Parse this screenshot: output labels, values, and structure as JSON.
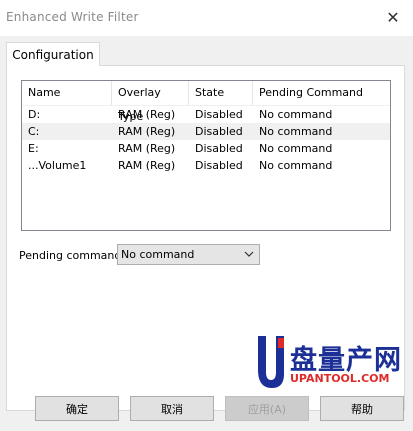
{
  "window": {
    "title": "Enhanced Write Filter",
    "close_glyph": "✕"
  },
  "tabs": [
    {
      "label": "Configuration"
    }
  ],
  "list": {
    "columns": [
      "Name",
      "Overlay Type",
      "State",
      "Pending Command"
    ],
    "rows": [
      [
        "D:",
        "RAM (Reg)",
        "Disabled",
        "No command"
      ],
      [
        "C:",
        "RAM (Reg)",
        "Disabled",
        "No command"
      ],
      [
        "E:",
        "RAM (Reg)",
        "Disabled",
        "No command"
      ],
      [
        "...Volume1",
        "RAM (Reg)",
        "Disabled",
        "No command"
      ]
    ],
    "selected_row_index": 1
  },
  "pending": {
    "label": "Pending command:",
    "value": "No command"
  },
  "buttons": {
    "ok": "确定",
    "cancel": "取消",
    "apply": "应用(A)",
    "help": "帮助"
  },
  "watermark": {
    "cn_text": "盘量产网",
    "en_text": "UPANTOOL.COM"
  },
  "colors": {
    "watermark_blue": "#1b2f96",
    "watermark_red": "#e02a2a",
    "selection_bg": "#f0f0f0"
  }
}
